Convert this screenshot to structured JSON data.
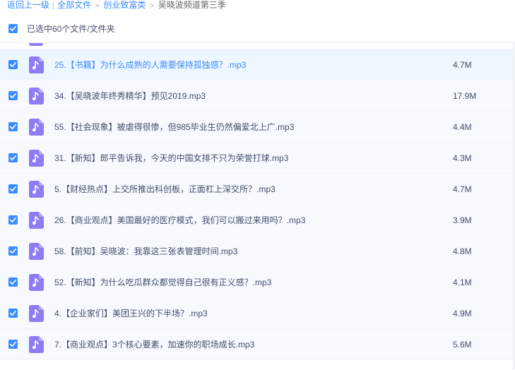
{
  "breadcrumb": {
    "back": "返回上一级",
    "all_files": "全部文件",
    "folder1": "创业致富类",
    "current": "吴晓波频道第三季"
  },
  "selection": {
    "label": "已选中60个文件/文件夹"
  },
  "colors": {
    "accent": "#3b8cff",
    "audio_icon": "#8d7cf3"
  },
  "files": [
    {
      "name": "25.【书籍】为什么成熟的人需要保持孤独感？.mp3",
      "size": "4.7M",
      "icon": "audio-file-icon",
      "checked": true
    },
    {
      "name": "34.【吴晓波年终秀精华】预见2019.mp3",
      "size": "17.9M",
      "icon": "audio-file-icon",
      "checked": true
    },
    {
      "name": "55.【社会现象】被虐得很惨，但985毕业生仍然偏爱北上广.mp3",
      "size": "4.4M",
      "icon": "audio-file-icon",
      "checked": true
    },
    {
      "name": "31.【新知】郎平告诉我，今天的中国女排不只为荣誉打球.mp3",
      "size": "4.3M",
      "icon": "audio-file-icon",
      "checked": true
    },
    {
      "name": "5.【财经热点】上交所推出科创板，正面杠上深交所？.mp3",
      "size": "4.7M",
      "icon": "audio-file-icon",
      "checked": true
    },
    {
      "name": "26.【商业观点】美国最好的医疗模式，我们可以搬过来用吗？.mp3",
      "size": "3.9M",
      "icon": "audio-file-icon",
      "checked": true
    },
    {
      "name": "58.【前知】吴晓波：我靠这三张表管理时间.mp3",
      "size": "4.8M",
      "icon": "audio-file-icon",
      "checked": true
    },
    {
      "name": "52.【新知】为什么吃瓜群众都觉得自己很有正义感？.mp3",
      "size": "4.1M",
      "icon": "audio-file-icon",
      "checked": true
    },
    {
      "name": "4.【企业家们】美团王兴的下半场？.mp3",
      "size": "4.9M",
      "icon": "audio-file-icon",
      "checked": true
    },
    {
      "name": "7.【商业观点】3个核心要素，加速你的职场成长.mp3",
      "size": "5.6M",
      "icon": "audio-file-icon",
      "checked": true
    }
  ]
}
